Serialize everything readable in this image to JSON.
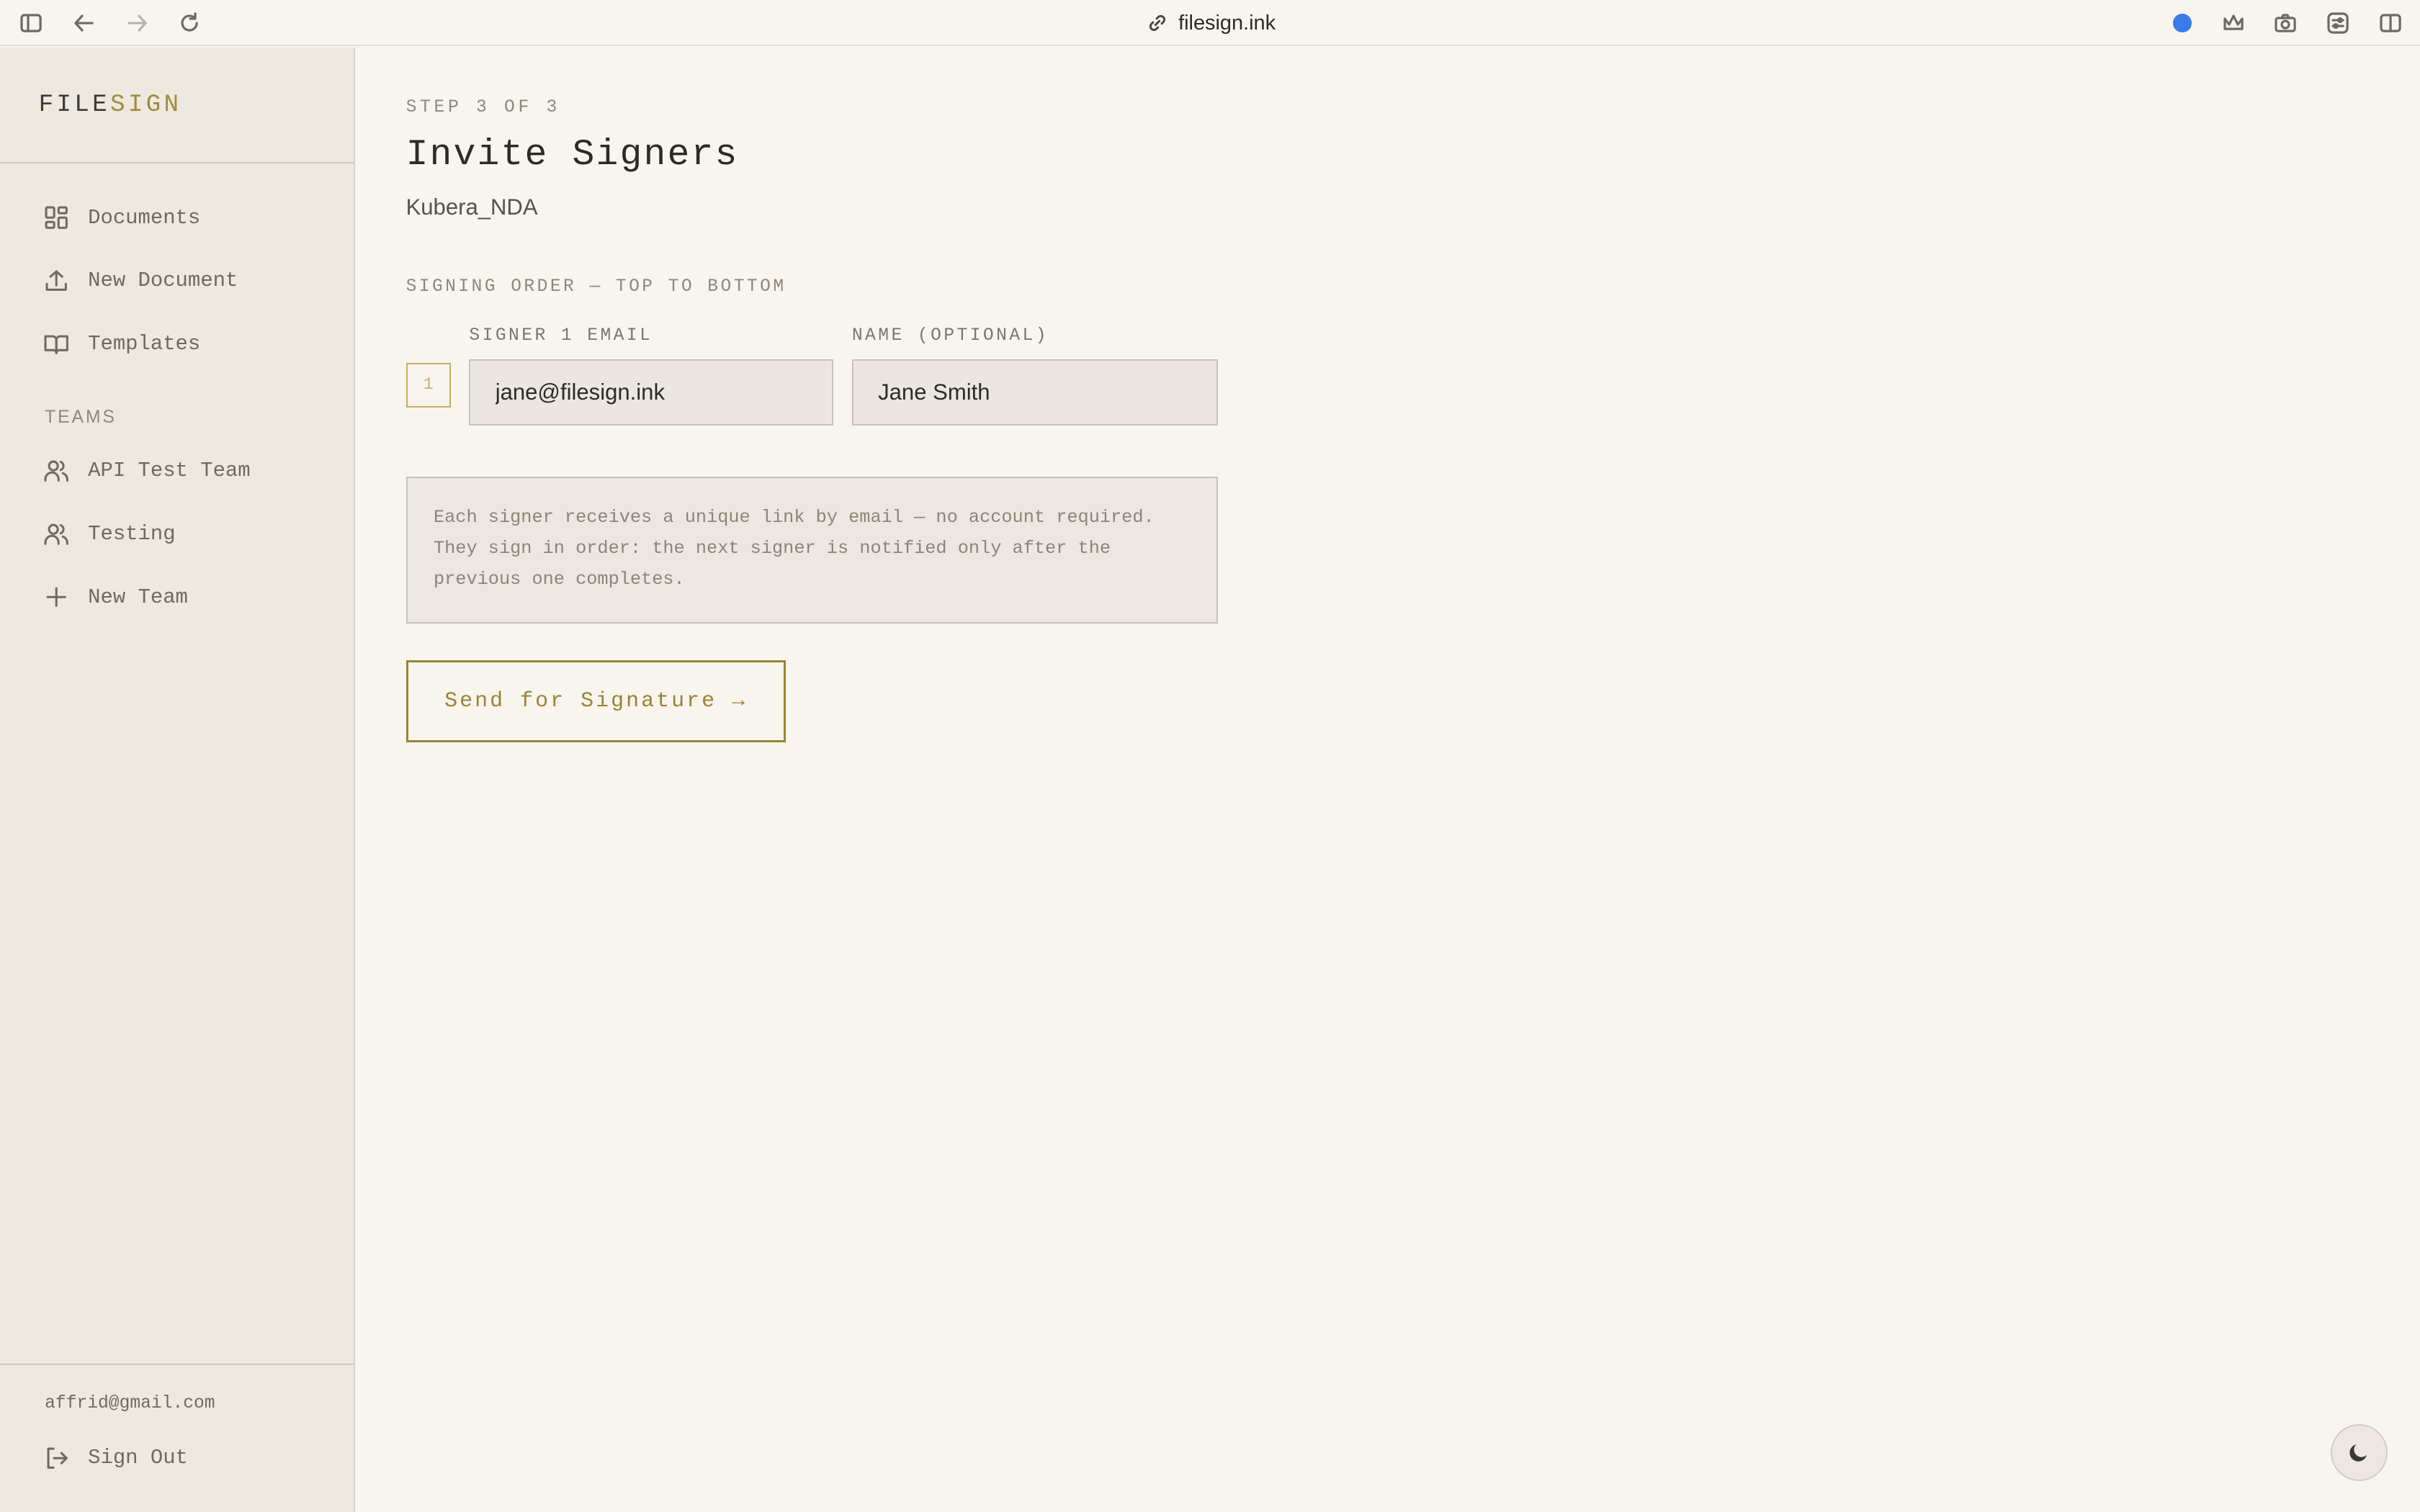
{
  "browser": {
    "url": "filesign.ink",
    "icons": [
      "sidebar-toggle-icon",
      "back-arrow-icon",
      "forward-arrow-icon",
      "reload-icon",
      "link-icon",
      "recording-dot-icon",
      "extension-icon",
      "camera-icon",
      "settings-sliders-icon",
      "split-view-icon"
    ],
    "accent_color": "#3b7be8"
  },
  "sidebar": {
    "logo": {
      "part1": "FILE",
      "part2": "SIGN"
    },
    "nav": [
      {
        "label": "Documents",
        "icon": "grid-icon"
      },
      {
        "label": "New Document",
        "icon": "upload-icon"
      },
      {
        "label": "Templates",
        "icon": "book-icon"
      }
    ],
    "teams_label": "TEAMS",
    "teams": [
      {
        "label": "API Test Team",
        "icon": "users-icon"
      },
      {
        "label": "Testing",
        "icon": "users-icon"
      },
      {
        "label": "New Team",
        "icon": "plus-icon"
      }
    ],
    "user_email": "affrid@gmail.com",
    "sign_out": "Sign Out"
  },
  "main": {
    "step": "STEP 3 OF 3",
    "title": "Invite Signers",
    "document_name": "Kubera_NDA",
    "signing_order_label": "SIGNING ORDER — TOP TO BOTTOM",
    "signers": [
      {
        "order": "1",
        "email_label": "SIGNER 1 EMAIL",
        "email_value": "jane@filesign.ink",
        "name_label": "NAME (OPTIONAL)",
        "name_value": "Jane Smith"
      }
    ],
    "info_text": "Each signer receives a unique link by email — no account required. They sign in order: the next signer is notified only after the previous one completes.",
    "send_button": "Send for Signature →",
    "accent_color": "#9c8334"
  },
  "theme_toggle_icon": "moon-icon"
}
